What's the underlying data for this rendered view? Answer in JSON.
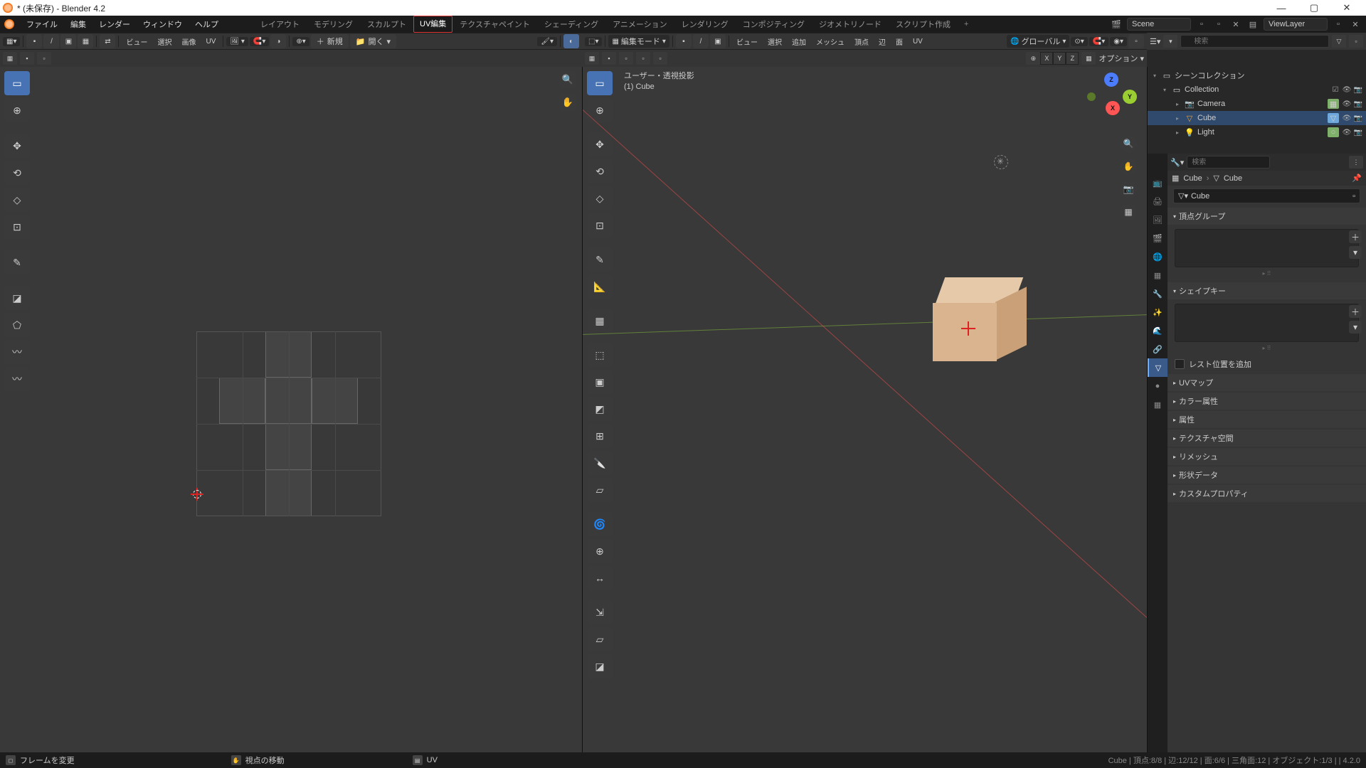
{
  "window": {
    "title": "* (未保存) - Blender 4.2"
  },
  "menu": {
    "file": "ファイル",
    "edit": "編集",
    "render": "レンダー",
    "window": "ウィンドウ",
    "help": "ヘルプ"
  },
  "tabs": [
    "レイアウト",
    "モデリング",
    "スカルプト",
    "UV編集",
    "テクスチャペイント",
    "シェーディング",
    "アニメーション",
    "レンダリング",
    "コンポジティング",
    "ジオメトリノード",
    "スクリプト作成"
  ],
  "active_tab": "UV編集",
  "scene": {
    "label": "Scene",
    "viewlayer": "ViewLayer"
  },
  "uv_header": {
    "view": "ビュー",
    "select": "選択",
    "image": "画像",
    "uv": "UV",
    "new": "新規",
    "open": "開く"
  },
  "v3d_header": {
    "mode": "編集モード",
    "view": "ビュー",
    "select": "選択",
    "add": "追加",
    "mesh": "メッシュ",
    "vertex": "頂点",
    "edge": "辺",
    "face": "面",
    "uv": "UV",
    "orient": "グローバル",
    "options": "オプション"
  },
  "v3d_info": {
    "line1": "ユーザー・透視投影",
    "line2": "(1) Cube"
  },
  "outliner": {
    "scene_collection": "シーンコレクション",
    "collection": "Collection",
    "items": [
      {
        "name": "Camera",
        "icon": "📷",
        "badge": "▦",
        "color": "#7fb069"
      },
      {
        "name": "Cube",
        "icon": "▽",
        "badge": "▽",
        "color": "#6fa8dc",
        "sel": true
      },
      {
        "name": "Light",
        "icon": "💡",
        "badge": "○",
        "color": "#7fb069"
      }
    ],
    "search": "検索"
  },
  "props": {
    "search": "検索",
    "crumb_obj": "Cube",
    "crumb_data": "Cube",
    "data_name": "Cube",
    "panels": {
      "vgroups": "頂点グループ",
      "shapekeys": "シェイプキー",
      "rest": "レスト位置を追加",
      "uvmaps": "UVマップ",
      "colorattr": "カラー属性",
      "attr": "属性",
      "texspace": "テクスチャ空間",
      "remesh": "リメッシュ",
      "geodata": "形状データ",
      "custom": "カスタムプロパティ"
    }
  },
  "status": {
    "left": [
      {
        "icon": "⬚",
        "text": "フレームを変更"
      },
      {
        "icon": "✋",
        "text": "視点の移動"
      },
      {
        "icon": "▤",
        "text": "UV"
      }
    ],
    "right": "Cube | 頂点:8/8 | 辺:12/12 | 面:6/6 | 三角面:12 | オブジェクト:1/3 |      | 4.2.0"
  },
  "axes": {
    "x": "X",
    "y": "Y",
    "z": "Z"
  }
}
